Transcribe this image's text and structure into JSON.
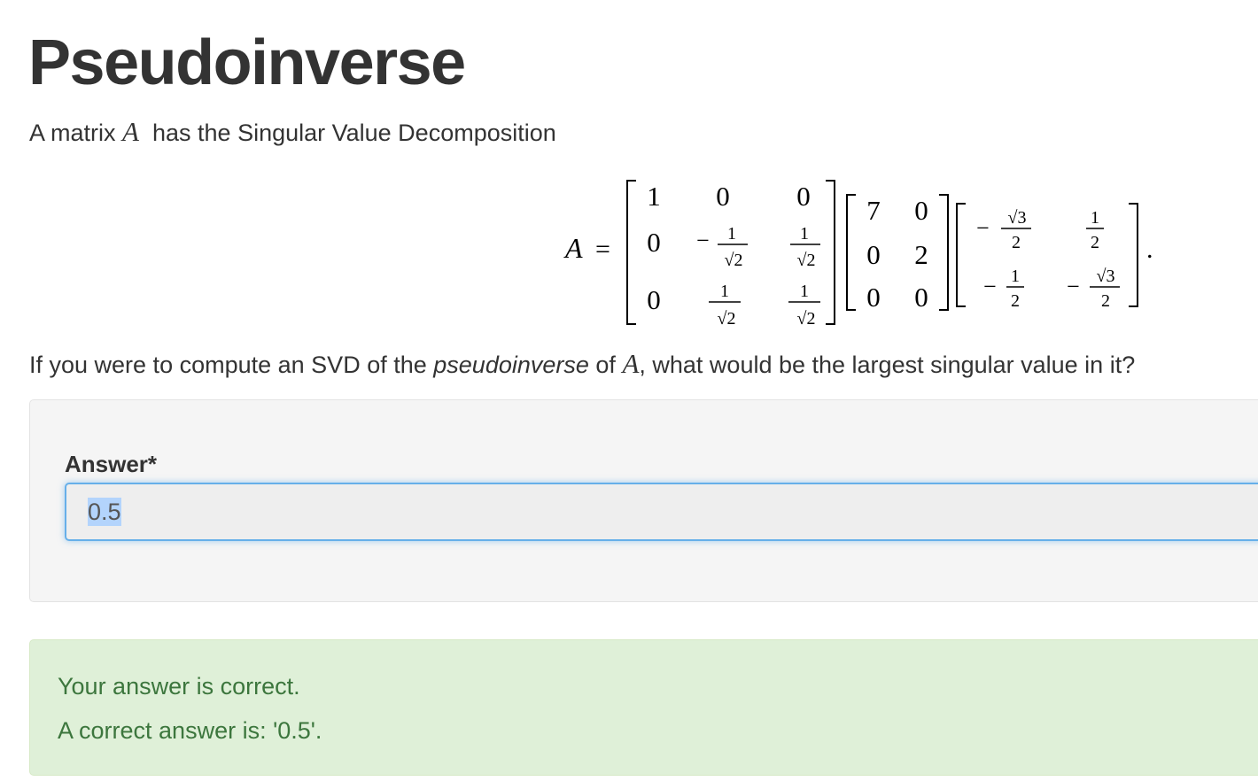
{
  "page": {
    "title": "Pseudoinverse"
  },
  "problem": {
    "intro_before": "A matrix",
    "intro_var": "A",
    "intro_after": "has the Singular Value Decomposition",
    "equation": {
      "lhs": "A =",
      "U": [
        [
          "1",
          "0",
          "0"
        ],
        [
          "0",
          "-1/√2",
          "1/√2"
        ],
        [
          "0",
          "1/√2",
          "1/√2"
        ]
      ],
      "Sigma": [
        [
          "7",
          "0"
        ],
        [
          "0",
          "2"
        ],
        [
          "0",
          "0"
        ]
      ],
      "VT": [
        [
          "-√3/2",
          "1/2"
        ],
        [
          "-1/2",
          "-√3/2"
        ]
      ],
      "trailing": "."
    },
    "question_before": "If you were to compute an SVD of the",
    "question_em": "pseudoinverse",
    "question_mid": "of",
    "question_var": "A",
    "question_after": ", what would be the largest singular value in it?"
  },
  "answer": {
    "label": "Answer*",
    "value": "0.5"
  },
  "feedback": {
    "status": "Your answer is correct.",
    "correct": "A correct answer is: '0.5'."
  },
  "colors": {
    "input_focus_border": "#66afe9",
    "success_bg": "#dff0d8",
    "success_text": "#3c763d",
    "well_bg": "#f5f5f5"
  }
}
